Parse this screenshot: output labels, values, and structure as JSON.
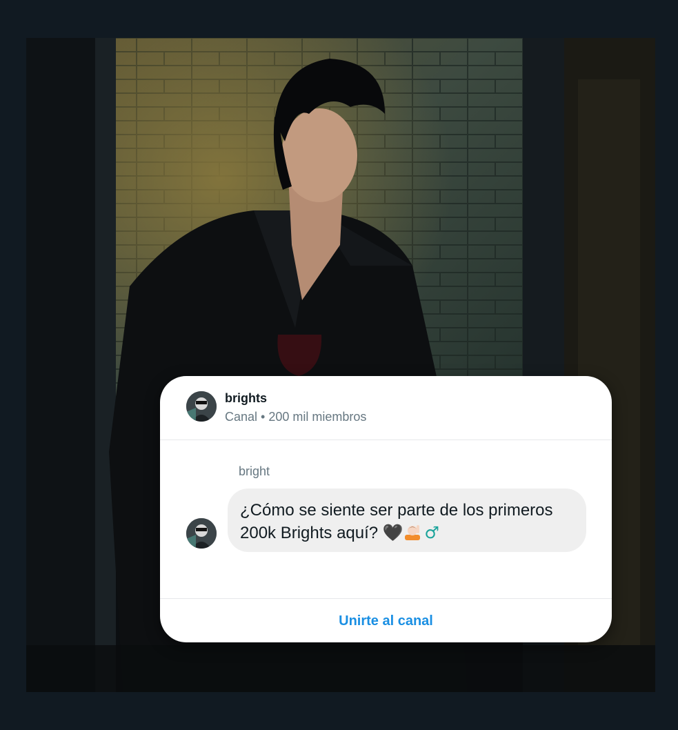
{
  "channel": {
    "name": "brights",
    "meta": "Canal • 200 mil miembros",
    "avatar_icon": "profile-photo-icon"
  },
  "message": {
    "sender": "bright",
    "text_line1": "¿Cómo se siente ser parte de los primeros",
    "text_line2": "200k Brights aquí?",
    "emoji_heart": "🖤",
    "emoji_male": "♂"
  },
  "footer": {
    "join_label": "Unirte al canal"
  },
  "colors": {
    "accent": "#1a8fe3",
    "page_background": "#111a22",
    "card_background": "#ffffff",
    "bubble_background": "#efefef",
    "secondary_text": "#667781"
  }
}
